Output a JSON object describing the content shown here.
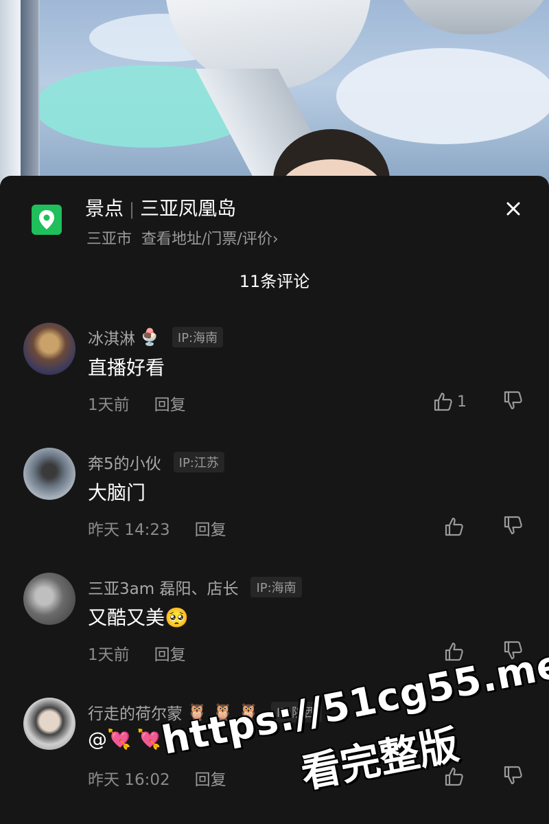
{
  "poi": {
    "category": "景点",
    "separator": "|",
    "name": "三亚凤凰岛",
    "city": "三亚市",
    "link_label": "查看地址/门票/评价",
    "link_chevron": "›",
    "icon": "location-pin-icon",
    "accent": "#1fbf5c"
  },
  "close_label": "×",
  "comment_count_label": "11条评论",
  "comments": [
    {
      "user": "冰淇淋",
      "user_emoji": "🍨",
      "ip": "IP:海南",
      "text": "直播好看",
      "time": "1天前",
      "reply_label": "回复",
      "likes": "1"
    },
    {
      "user": "奔5的小伙",
      "user_emoji": "",
      "ip": "IP:江苏",
      "text": "大脑门",
      "time": "昨天 14:23",
      "reply_label": "回复",
      "likes": ""
    },
    {
      "user": "三亚3am 磊阳、店长",
      "user_emoji": "",
      "ip": "IP:海南",
      "text": "又酷又美🥺",
      "time": "1天前",
      "reply_label": "回复",
      "likes": ""
    },
    {
      "user": "行走的荷尔蒙",
      "user_emoji": "🦉 🦉 🦉",
      "ip": "IP:陕西",
      "text": "@💘 💘",
      "time": "昨天 16:02",
      "reply_label": "回复",
      "likes": ""
    }
  ],
  "watermark": {
    "line1": "https://51cg55.me",
    "line2": "看完整版"
  }
}
